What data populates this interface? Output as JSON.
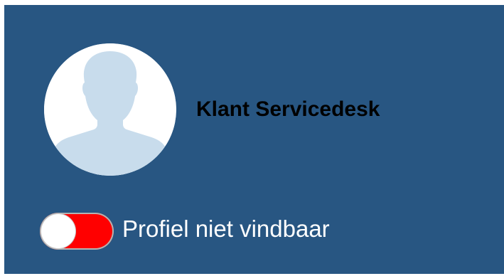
{
  "profile": {
    "name": "Klant Servicedesk",
    "avatar_icon": "user-placeholder-icon"
  },
  "visibility_toggle": {
    "label": "Profiel niet vindbaar",
    "state": "off",
    "track_color": "#ff0000",
    "knob_color": "#ffffff"
  },
  "colors": {
    "panel_background": "#285682",
    "avatar_silhouette": "#c8dcec",
    "name_text": "#000000",
    "label_text": "#ffffff"
  }
}
